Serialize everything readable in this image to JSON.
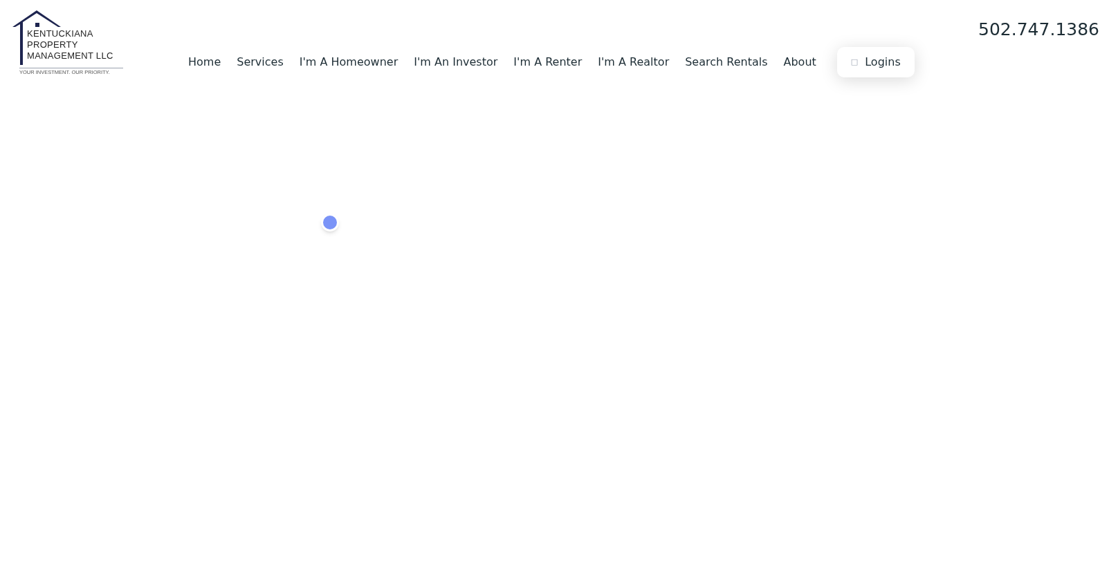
{
  "logo": {
    "lines": [
      "KENTUCKIANA",
      "PROPERTY",
      "MANAGEMENT LLC"
    ],
    "tagline": "YOUR INVESTMENT. OUR PRIORITY."
  },
  "nav": [
    {
      "label": "Home"
    },
    {
      "label": "Services"
    },
    {
      "label": "I'm A Homeowner"
    },
    {
      "label": "I'm An Investor"
    },
    {
      "label": "I'm A Renter"
    },
    {
      "label": "I'm A Realtor"
    },
    {
      "label": "Search Rentals"
    },
    {
      "label": "About"
    }
  ],
  "logins_button": {
    "icon": "□",
    "label": "Logins"
  },
  "phone": "502.747.1386"
}
